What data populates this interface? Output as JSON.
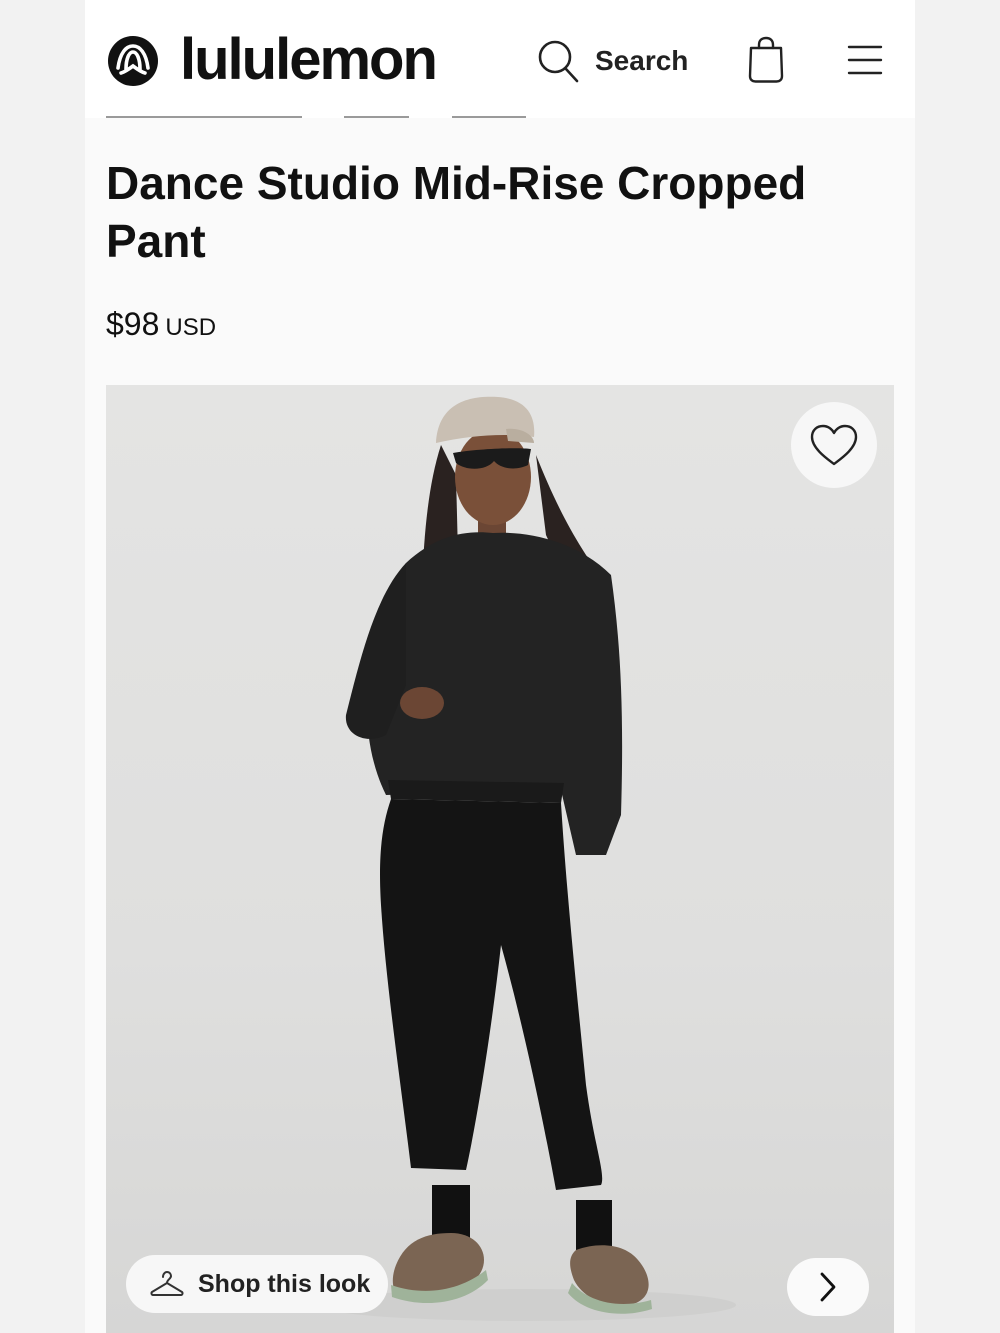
{
  "header": {
    "brand_name": "lululemon",
    "search_label": "Search",
    "icons": {
      "logo": "lululemon-logo-icon",
      "search": "search-icon",
      "bag": "shopping-bag-icon",
      "menu": "hamburger-menu-icon"
    }
  },
  "product": {
    "title": "Dance Studio Mid-Rise Cropped Pant",
    "price": "$98",
    "currency": "USD"
  },
  "gallery": {
    "shop_look_label": "Shop this look",
    "icons": {
      "favorite": "heart-icon",
      "shop_look": "hanger-icon",
      "next": "chevron-right-icon"
    }
  },
  "colors": {
    "text": "#111111",
    "page_background": "#fafafa",
    "photo_background": "#e2e2e1"
  }
}
